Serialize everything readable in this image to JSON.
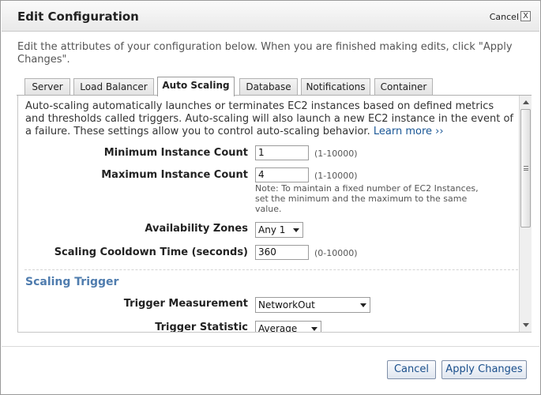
{
  "dialog": {
    "title": "Edit Configuration",
    "cancel_link": "Cancel",
    "close_glyph": "X"
  },
  "intro": "Edit the attributes of your configuration below. When you are finished making edits, click \"Apply Changes\".",
  "tabs": [
    {
      "label": "Server",
      "active": false
    },
    {
      "label": "Load Balancer",
      "active": false
    },
    {
      "label": "Auto Scaling",
      "active": true
    },
    {
      "label": "Database",
      "active": false
    },
    {
      "label": "Notifications",
      "active": false
    },
    {
      "label": "Container",
      "active": false
    }
  ],
  "panel": {
    "description": "Auto-scaling automatically launches or terminates EC2 instances based on defined metrics and thresholds called triggers. Auto-scaling will also launch a new EC2 instance in the event of a failure. These settings allow you to control auto-scaling behavior.",
    "learn_more": "Learn more ››",
    "min_count": {
      "label": "Minimum Instance Count",
      "value": "1",
      "hint": "(1-10000)"
    },
    "max_count": {
      "label": "Maximum Instance Count",
      "value": "4",
      "hint": "(1-10000)",
      "note": "Note: To maintain a fixed number of EC2 Instances, set the minimum and the maximum to the same value."
    },
    "zones": {
      "label": "Availability Zones",
      "value": "Any 1"
    },
    "cooldown": {
      "label": "Scaling Cooldown Time (seconds)",
      "value": "360",
      "hint": "(0-10000)"
    },
    "section_title": "Scaling Trigger",
    "trigger_measurement": {
      "label": "Trigger Measurement",
      "value": "NetworkOut"
    },
    "trigger_statistic": {
      "label": "Trigger Statistic",
      "value": "Average"
    }
  },
  "buttons": {
    "cancel": "Cancel",
    "apply": "Apply Changes"
  },
  "colors": {
    "accent": "#4f7cae",
    "link": "#1a5796",
    "button_text": "#1a4f8c"
  },
  "icons": [
    "close-icon",
    "scroll-up-icon",
    "scroll-down-icon",
    "dropdown-arrow-icon"
  ]
}
